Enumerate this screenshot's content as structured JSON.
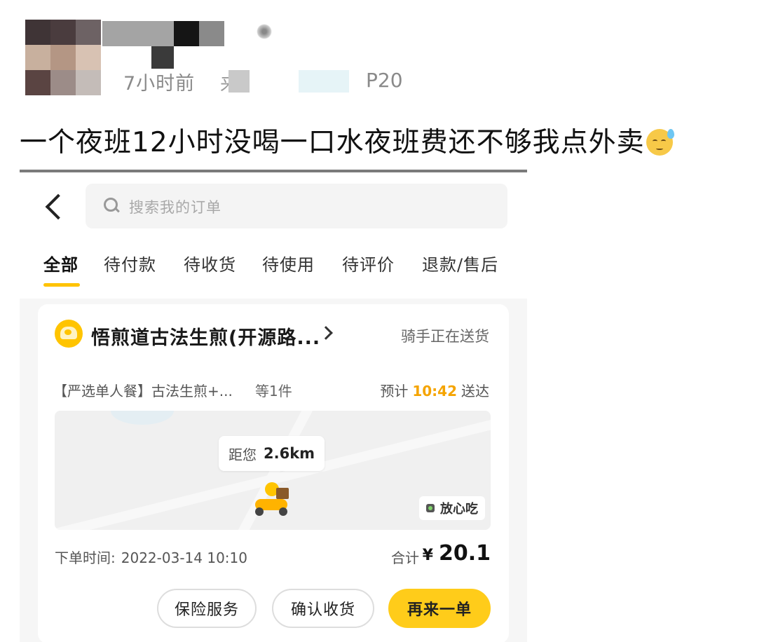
{
  "post": {
    "time_ago": "7小时前",
    "source_prefix": "来",
    "device_suffix": "P20",
    "text": "一个夜班12小时没喝一口水夜班费还不够我点外卖"
  },
  "emoji": {
    "name": "sweat-emoji",
    "color": "#f7c948"
  },
  "app": {
    "search": {
      "placeholder": "搜索我的订单"
    },
    "tabs": [
      {
        "label": "全部",
        "active": true
      },
      {
        "label": "待付款"
      },
      {
        "label": "待收货"
      },
      {
        "label": "待使用"
      },
      {
        "label": "待评价"
      },
      {
        "label": "退款/售后"
      }
    ],
    "order": {
      "store_name": "悟煎道古法生煎(开源路...",
      "status": "骑手正在送货",
      "item_desc": "【严选单人餐】古法生煎+...",
      "item_count": "等1件",
      "eta_prefix": "预计",
      "eta_time": "10:42",
      "eta_suffix": "送达",
      "distance_label": "距您",
      "distance_value": "2.6km",
      "safe_label": "放心吃",
      "order_time_label": "下单时间:",
      "order_time_value": "2022-03-14 10:10",
      "total_label": "合计",
      "currency": "¥",
      "total_value": "20.1",
      "buttons": {
        "insurance": "保险服务",
        "confirm": "确认收货",
        "reorder": "再来一单"
      }
    },
    "accent_color": "#ffc300"
  }
}
